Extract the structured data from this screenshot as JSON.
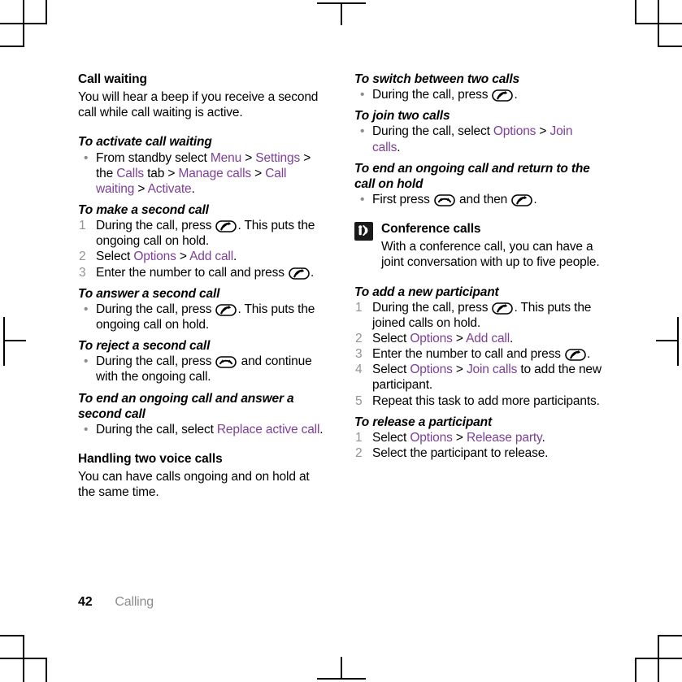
{
  "document": {
    "footer": {
      "page_number": "42",
      "running_head": "Calling"
    },
    "link_color": "#7d3f98",
    "number_color": "#939393"
  },
  "left_column": {
    "section": {
      "title": "Call waiting",
      "body": "You will hear a beep if you receive a second call while call waiting is active."
    },
    "task_activate": {
      "title": "To activate call waiting",
      "step1": {
        "t1": "From standby select ",
        "l1": "Menu",
        "t2": " > ",
        "l2": "Settings",
        "t3": " > the ",
        "l3": "Calls",
        "t4": " tab > ",
        "l4": "Manage calls",
        "t5": " > ",
        "l5": "Call waiting",
        "t6": " > ",
        "l6": "Activate",
        "t7": "."
      }
    },
    "task_second_call": {
      "title": "To make a second call",
      "step1": {
        "num": "1",
        "t1": "During the call, press ",
        "icon": "call-key-icon",
        "t2": ". This puts the ongoing call on hold."
      },
      "step2": {
        "num": "2",
        "t1": "Select ",
        "l1": "Options",
        "t2": " > ",
        "l2": "Add call",
        "t3": "."
      },
      "step3": {
        "num": "3",
        "t1": "Enter the number to call and press ",
        "icon": "call-key-icon",
        "t2": "."
      }
    },
    "task_answer": {
      "title": "To answer a second call",
      "step1": {
        "t1": "During the call, press ",
        "icon": "call-key-icon",
        "t2": ". This puts the ongoing call on hold."
      }
    },
    "task_reject": {
      "title": "To reject a second call",
      "step1": {
        "t1": "During the call, press ",
        "icon": "end-call-key-icon",
        "t2": " and continue with the ongoing call."
      }
    },
    "task_end_answer": {
      "title": "To end an ongoing call and answer a second call",
      "step1": {
        "t1": "During the call, select ",
        "l1": "Replace active call",
        "t2": "."
      }
    },
    "section_two": {
      "title": "Handling two voice calls",
      "body": "You can have calls ongoing and on hold at the same time."
    }
  },
  "right_column": {
    "task_switch": {
      "title": "To switch between two calls",
      "step1": {
        "t1": "During the call, press ",
        "icon": "call-key-icon",
        "t2": "."
      }
    },
    "task_join": {
      "title": "To join two calls",
      "step1": {
        "t1": "During the call, select ",
        "l1": "Options",
        "t2": " > ",
        "l2": "Join calls",
        "t3": "."
      }
    },
    "task_end_return": {
      "title": "To end an ongoing call and return to the call on hold",
      "step1": {
        "t1": "First press ",
        "icon1": "end-call-key-icon",
        "t2": " and then ",
        "icon2": "call-key-icon",
        "t3": "."
      }
    },
    "tip": {
      "icon": "conference-call-icon",
      "title": "Conference calls",
      "body": "With a conference call, you can have a joint conversation with up to five people."
    },
    "task_add_participant": {
      "title": "To add a new participant",
      "step1": {
        "num": "1",
        "t1": "During the call, press ",
        "icon": "call-key-icon",
        "t2": ". This puts the joined calls on hold."
      },
      "step2": {
        "num": "2",
        "t1": "Select ",
        "l1": "Options",
        "t2": " > ",
        "l2": "Add call",
        "t3": "."
      },
      "step3": {
        "num": "3",
        "t1": "Enter the number to call and press ",
        "icon": "call-key-icon",
        "t2": "."
      },
      "step4": {
        "num": "4",
        "t1": "Select ",
        "l1": "Options",
        "t2": " > ",
        "l2": "Join calls",
        "t3": " to add the new participant."
      },
      "step5": {
        "num": "5",
        "t1": "Repeat this task to add more participants."
      }
    },
    "task_release": {
      "title": "To release a participant",
      "step1": {
        "num": "1",
        "t1": "Select ",
        "l1": "Options",
        "t2": " > ",
        "l2": "Release party",
        "t3": "."
      },
      "step2": {
        "num": "2",
        "t1": "Select the participant to release."
      }
    }
  }
}
